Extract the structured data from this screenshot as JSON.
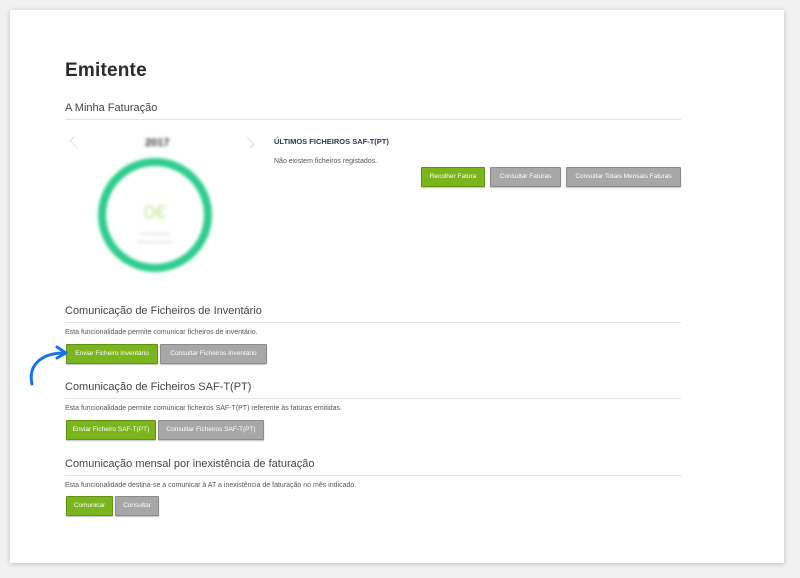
{
  "header": {
    "title": "Emitente"
  },
  "billing": {
    "title": "A Minha Faturação",
    "year": "2017",
    "amount": "0€",
    "gauge_line1": "Ver documentos",
    "gauge_line2": "Faturas por emissor",
    "files_title": "ÚLTIMOS FICHEIROS SAF-T(PT)",
    "no_files": "Não existem ficheiros registados.",
    "buttons": {
      "collect": "Recolher Fatura",
      "consult_invoices": "Consultar Faturas",
      "monthly_totals": "Consultar Totais Mensais Faturas"
    }
  },
  "inventory": {
    "title": "Comunicação de Ficheiros de Inventário",
    "desc": "Esta funcionalidade permite comunicar ficheiros de inventário.",
    "send": "Enviar Ficheiro Inventário",
    "consult": "Consultar Ficheiros Inventário"
  },
  "saft": {
    "title": "Comunicação de Ficheiros SAF-T(PT)",
    "desc": "Esta funcionalidade permite comunicar ficheiros SAF-T(PT) referente às faturas emitidas.",
    "send": "Enviar Ficheiro SAF-T(PT)",
    "consult": "Consultar Ficheiros SAF-T(PT)"
  },
  "monthly": {
    "title": "Comunicação mensal por inexistência de faturação",
    "desc": "Esta funcionalidade destina-se a comunicar à AT a inexistência de faturação no mês indicado.",
    "communicate": "Comunicar",
    "consult": "Consultar"
  },
  "colors": {
    "accent_green": "#7ab51d",
    "gauge_green": "#2ecc8f",
    "button_grey": "#a7a7a7",
    "arrow_blue": "#1a73e8"
  },
  "icons": [
    "chevron-left-icon",
    "chevron-right-icon",
    "curved-arrow-icon"
  ]
}
